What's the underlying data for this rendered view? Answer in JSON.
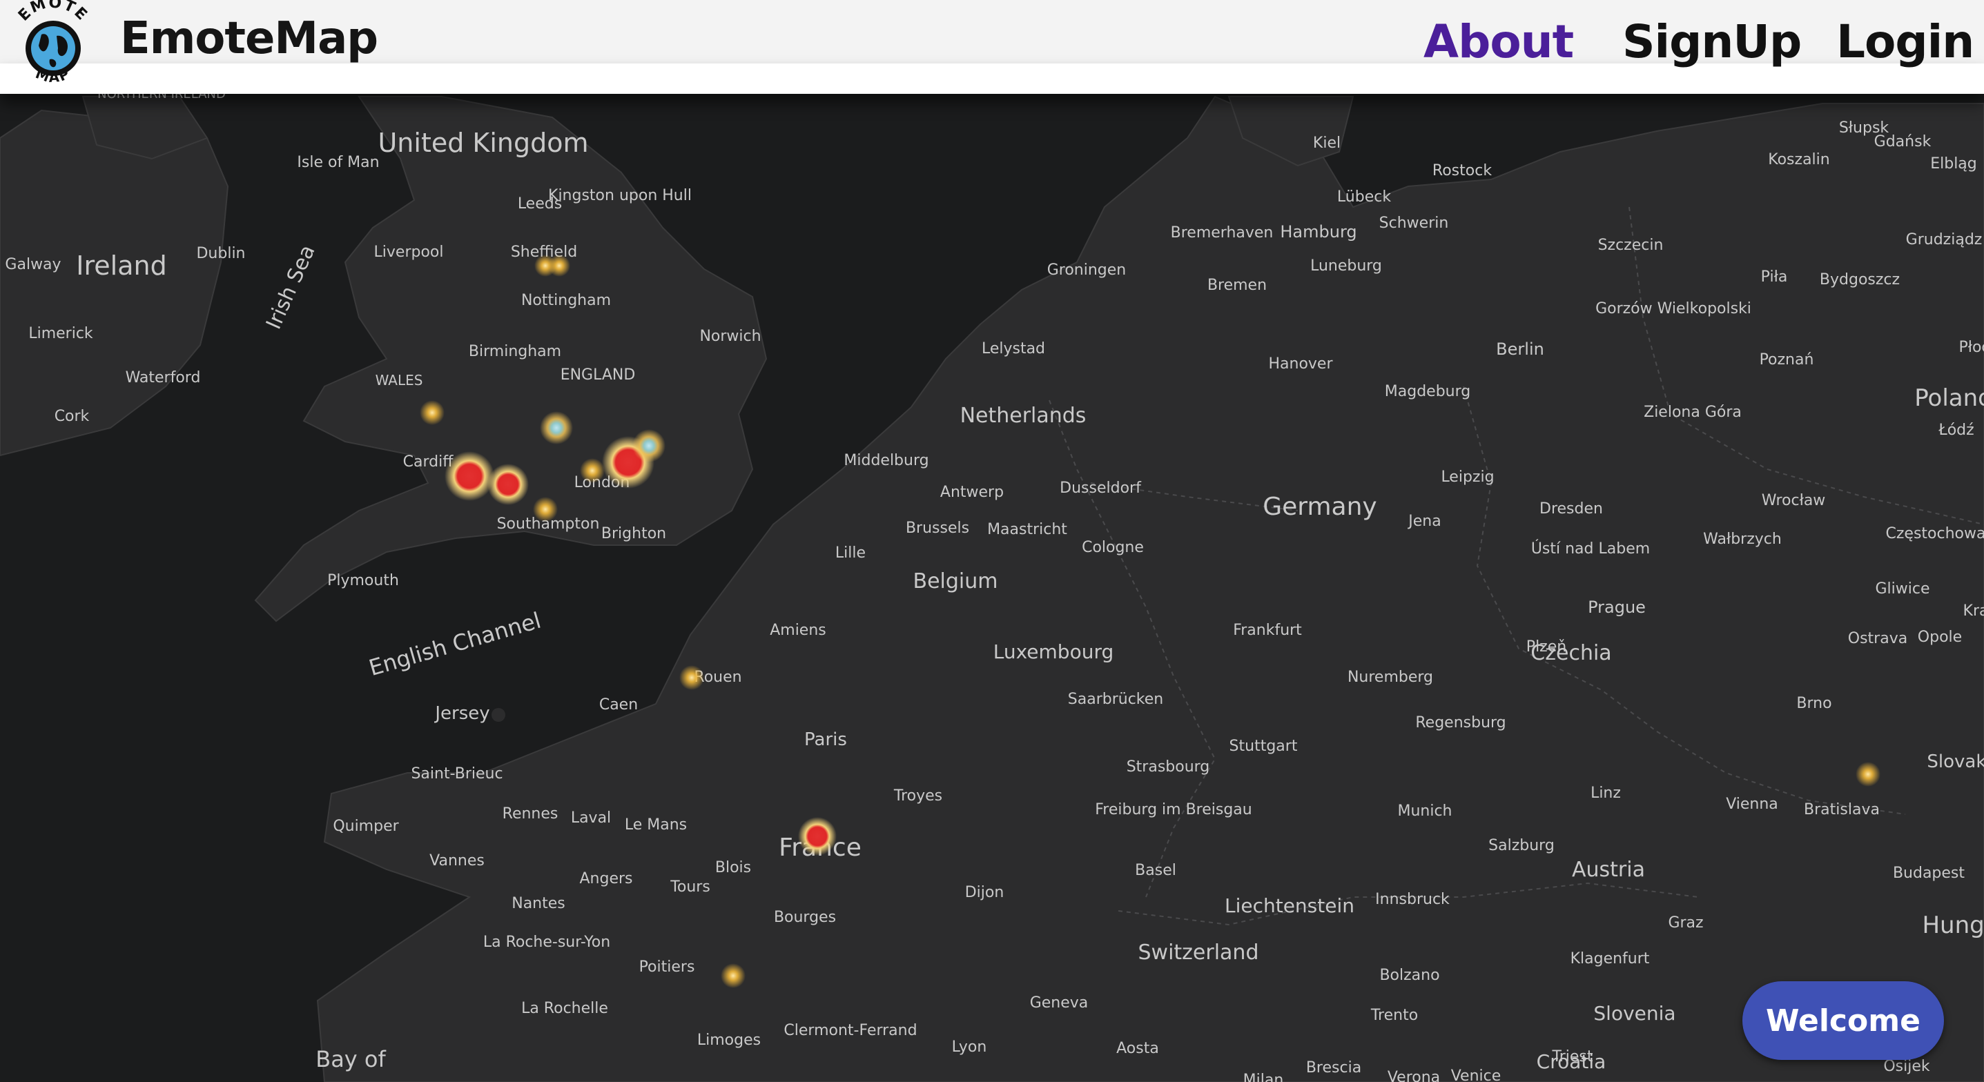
{
  "header": {
    "brand": "EmoteMap",
    "logo_text_top": "EMOTE",
    "logo_text_bottom": "MAP",
    "nav": [
      {
        "label": "About",
        "active": true
      },
      {
        "label": "SignUp",
        "active": false
      },
      {
        "label": "Login",
        "active": false
      }
    ],
    "accent_color": "#4b1f9a"
  },
  "welcome_button": {
    "label": "Welcome",
    "color": "#3f51b5"
  },
  "map": {
    "style": "dark",
    "countries": [
      "United Kingdom",
      "Ireland",
      "Netherlands",
      "Belgium",
      "Luxembourg",
      "Germany",
      "France",
      "Switzerland",
      "Liechtenstein",
      "Austria",
      "Czechia",
      "Poland",
      "Slovenia",
      "Croatia",
      "Slovaki",
      "Hunga"
    ],
    "regions": [
      "NORTHERN IRELAND",
      "WALES",
      "ENGLAND"
    ],
    "seas": [
      "Irish Sea",
      "English Channel",
      "Bay of"
    ],
    "cities": [
      "Isle of Man",
      "Kingston upon Hull",
      "Leeds",
      "Sheffield",
      "Liverpool",
      "Dublin",
      "Galway",
      "Limerick",
      "Waterford",
      "Cork",
      "Nottingham",
      "Birmingham",
      "Norwich",
      "Cardiff",
      "London",
      "Southampton",
      "Brighton",
      "Plymouth",
      "Jersey",
      "Saint-Brieuc",
      "Quimper",
      "Rennes",
      "Laval",
      "Le Mans",
      "Vannes",
      "Angers",
      "Nantes",
      "Tours",
      "Blois",
      "La Roche-sur-Yon",
      "Poitiers",
      "La Rochelle",
      "Limoges",
      "Bourges",
      "Clermont-Ferrand",
      "Lyon",
      "Geneva",
      "Caen",
      "Rouen",
      "Amiens",
      "Paris",
      "Troyes",
      "Dijon",
      "Lille",
      "Brussels",
      "Antwerp",
      "Middelburg",
      "Maastricht",
      "Cologne",
      "Dusseldorf",
      "Lelystad",
      "Groningen",
      "Bremerhaven",
      "Bremen",
      "Hamburg",
      "Luneburg",
      "Lübeck",
      "Kiel",
      "Rostock",
      "Schwerin",
      "Hanover",
      "Magdeburg",
      "Berlin",
      "Leipzig",
      "Dresden",
      "Jena",
      "Frankfurt",
      "Saarbrücken",
      "Strasbourg",
      "Stuttgart",
      "Freiburg im Breisgau",
      "Basel",
      "Nuremberg",
      "Regensburg",
      "Munich",
      "Salzburg",
      "Innsbruck",
      "Bolzano",
      "Trento",
      "Brescia",
      "Verona",
      "Venice",
      "Milan",
      "Aosta",
      "Klagenfurt",
      "Graz",
      "Triest",
      "Linz",
      "Vienna",
      "Bratislava",
      "Brno",
      "Budapest",
      "Prague",
      "Plzeň",
      "Ústí nad Labem",
      "Wrocław",
      "Wałbrzych",
      "Opole",
      "Ostrava",
      "Częstochowa",
      "Gliwice",
      "Kra",
      "Zielona Góra",
      "Poznań",
      "Łódź",
      "Piła",
      "Bydgoszcz",
      "Grudziądz",
      "Gorzów Wielkopolski",
      "Szczecin",
      "Koszalin",
      "Słupsk",
      "Gdańsk",
      "Elbląg",
      "Płoc",
      "Osijek"
    ],
    "emotion_markers": [
      {
        "place": "Sheffield",
        "intensity": "low"
      },
      {
        "place": "Wales",
        "intensity": "low"
      },
      {
        "place": "Oxford area",
        "intensity": "medium"
      },
      {
        "place": "Bristol",
        "intensity": "high"
      },
      {
        "place": "Swindon area",
        "intensity": "high"
      },
      {
        "place": "Winchester area",
        "intensity": "low"
      },
      {
        "place": "Reading area",
        "intensity": "low"
      },
      {
        "place": "London",
        "intensity": "high"
      },
      {
        "place": "London East",
        "intensity": "medium"
      },
      {
        "place": "Rouen",
        "intensity": "low"
      },
      {
        "place": "France (Orléans)",
        "intensity": "high"
      },
      {
        "place": "Poitiers area",
        "intensity": "low"
      },
      {
        "place": "Bratislava area",
        "intensity": "low"
      }
    ]
  }
}
